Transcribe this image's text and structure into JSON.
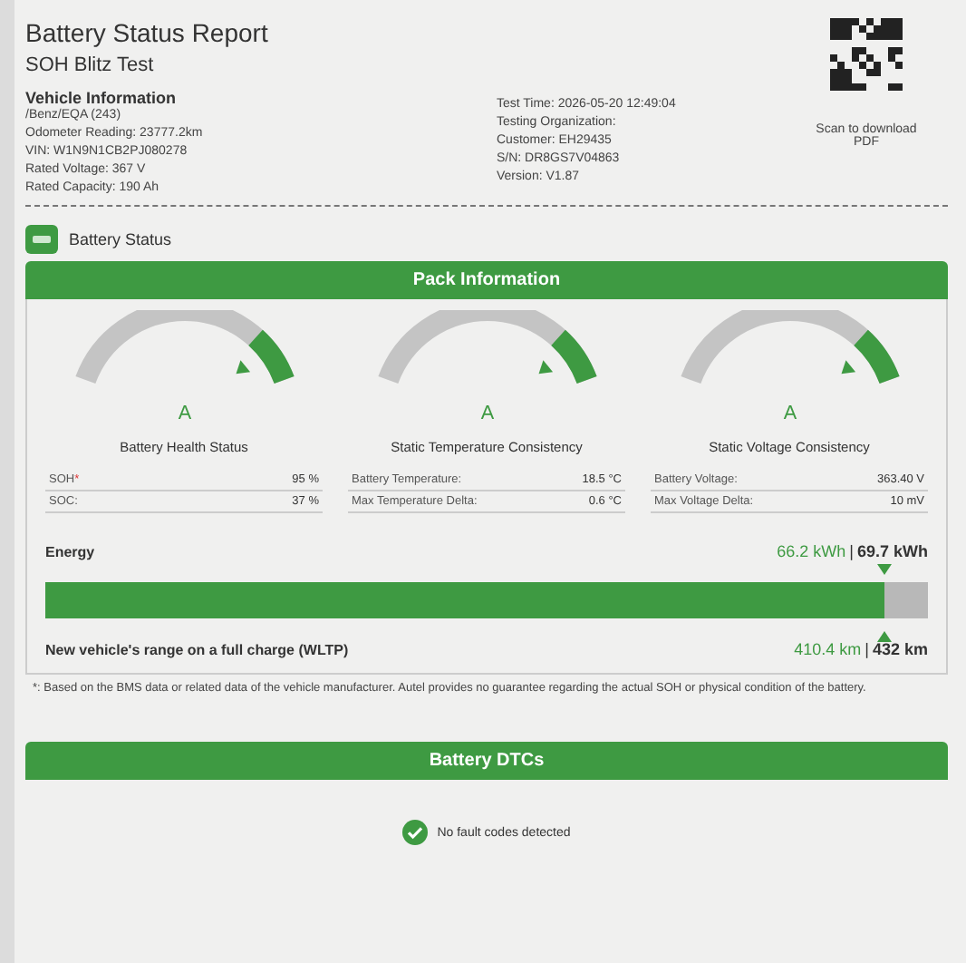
{
  "report": {
    "title": "Battery Status Report",
    "subtitle": "SOH Blitz Test"
  },
  "vehicle_info": {
    "heading": "Vehicle Information",
    "lines": [
      "/Benz/EQA (243)",
      "Odometer Reading: 23777.2km",
      "VIN: W1N9N1CB2PJ080278",
      "Rated Voltage: 367 V",
      "Rated Capacity: 190 Ah"
    ]
  },
  "test_info": [
    "Test Time: 2026-05-20 12:49:04",
    "Testing Organization:",
    "Customer: EH29435",
    "S/N: DR8GS7V04863",
    "Version: V1.87"
  ],
  "qr": {
    "caption": "Scan to download PDF"
  },
  "section": {
    "title": "Battery Status"
  },
  "pack": {
    "title": "Pack Information",
    "gauges": [
      {
        "grade": "A",
        "title": "Battery Health Status",
        "rows": [
          {
            "label": "SOH",
            "mark": "*",
            "value": "95 %"
          },
          {
            "label": "SOC:",
            "value": "37 %"
          }
        ]
      },
      {
        "grade": "A",
        "title": "Static Temperature Consistency",
        "rows": [
          {
            "label": "Battery Temperature:",
            "value": "18.5 °C"
          },
          {
            "label": "Max Temperature Delta:",
            "value": "0.6 °C"
          }
        ]
      },
      {
        "grade": "A",
        "title": "Static Voltage Consistency",
        "rows": [
          {
            "label": "Battery Voltage:",
            "value": "363.40 V"
          },
          {
            "label": "Max Voltage Delta:",
            "value": "10 mV"
          }
        ]
      }
    ],
    "energy": {
      "label": "Energy",
      "current": "66.2 kWh",
      "separator": "|",
      "rated": "69.7 kWh",
      "level": 0.95,
      "range_label": "New vehicle's range on a full charge (WLTP)",
      "range_current": "410.4 km",
      "range_separator": "|",
      "range_rated": "432 km"
    }
  },
  "footnote": "*: Based on the BMS data or related data of the vehicle manufacturer. Autel provides no guarantee regarding the actual SOH or physical condition of the battery.",
  "dtc": {
    "title": "Battery DTCs",
    "message": "No fault codes detected"
  }
}
